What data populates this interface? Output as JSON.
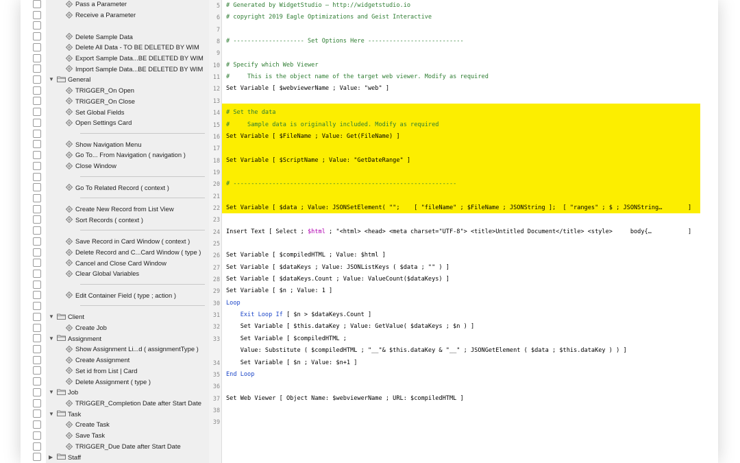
{
  "scripts": [
    {
      "type": "script",
      "label": "Pass a Parameter"
    },
    {
      "type": "script",
      "label": "Receive a Parameter"
    },
    {
      "type": "blank"
    },
    {
      "type": "script",
      "label": "Delete Sample Data"
    },
    {
      "type": "script",
      "label": "Delete All Data - TO BE DELETED BY WIM"
    },
    {
      "type": "script",
      "label": "Export Sample Data...BE DELETED BY WIM"
    },
    {
      "type": "script",
      "label": "Import Sample Data...BE DELETED BY WIM"
    },
    {
      "type": "folder",
      "label": "General"
    },
    {
      "type": "script",
      "label": "TRIGGER_On Open"
    },
    {
      "type": "script",
      "label": "TRIGGER_On Close"
    },
    {
      "type": "script",
      "label": "Set Global Fields"
    },
    {
      "type": "script",
      "label": "Open Settings Card"
    },
    {
      "type": "sep"
    },
    {
      "type": "script",
      "label": "Show Navigation Menu"
    },
    {
      "type": "script",
      "label": "Go To... From Navigation ( navigation )"
    },
    {
      "type": "script",
      "label": "Close Window"
    },
    {
      "type": "sep"
    },
    {
      "type": "script",
      "label": "Go To Related Record ( context )"
    },
    {
      "type": "sep"
    },
    {
      "type": "script",
      "label": "Create New Record from List View"
    },
    {
      "type": "script",
      "label": "Sort Records ( context )"
    },
    {
      "type": "sep"
    },
    {
      "type": "script",
      "label": "Save Record in Card Window ( context )"
    },
    {
      "type": "script",
      "label": "Delete Record and C...Card Window ( type )"
    },
    {
      "type": "script",
      "label": "Cancel and Close Card Window"
    },
    {
      "type": "script",
      "label": "Clear Global Variables"
    },
    {
      "type": "sep"
    },
    {
      "type": "script",
      "label": "Edit Container Field ( type ; action )"
    },
    {
      "type": "sep"
    },
    {
      "type": "folder",
      "label": "Client"
    },
    {
      "type": "script",
      "label": "Create Job"
    },
    {
      "type": "folder",
      "label": "Assignment"
    },
    {
      "type": "script",
      "label": "Show Assignment Li...d ( assignmentType )"
    },
    {
      "type": "script",
      "label": "Create Assignment"
    },
    {
      "type": "script",
      "label": "Set id from List | Card"
    },
    {
      "type": "script",
      "label": "Delete Assignment ( type )"
    },
    {
      "type": "folder",
      "label": "Job"
    },
    {
      "type": "script",
      "label": "TRIGGER_Completion Date after Start Date"
    },
    {
      "type": "folder",
      "label": "Task"
    },
    {
      "type": "script",
      "label": "Create Task"
    },
    {
      "type": "script",
      "label": "Save Task"
    },
    {
      "type": "script",
      "label": "TRIGGER_Due Date after Start Date"
    },
    {
      "type": "folder_collapsed",
      "label": "Staff"
    }
  ],
  "code_lines": [
    {
      "n": "5",
      "segments": [
        {
          "t": "# Generated by WidgetStudio – http://widgetstudio.io",
          "c": "green"
        }
      ]
    },
    {
      "n": "6",
      "segments": [
        {
          "t": "# copyright 2019 Eagle Optimizations and Geist Interactive",
          "c": "green"
        }
      ]
    },
    {
      "n": "7",
      "segments": []
    },
    {
      "n": "8",
      "segments": [
        {
          "t": "# -------------------- Set Options Here ---------------------------",
          "c": "green"
        }
      ]
    },
    {
      "n": "9",
      "segments": []
    },
    {
      "n": "10",
      "segments": [
        {
          "t": "# Specify which Web Viewer",
          "c": "green"
        }
      ]
    },
    {
      "n": "11",
      "segments": [
        {
          "t": "#     This is the object name of the target web viewer. Modify as required",
          "c": "green"
        }
      ]
    },
    {
      "n": "12",
      "segments": [
        {
          "t": "Set Variable [ $webviewerName ; Value: \"web\" ]",
          "c": "black"
        }
      ]
    },
    {
      "n": "13",
      "segments": []
    },
    {
      "n": "14",
      "segments": [
        {
          "t": "# Set the data",
          "c": "green"
        }
      ]
    },
    {
      "n": "15",
      "segments": [
        {
          "t": "#     Sample data is originally included. Modify as required",
          "c": "green"
        }
      ]
    },
    {
      "n": "16",
      "segments": [
        {
          "t": "Set Variable [ $FileName ; Value: Get(FileName) ]",
          "c": "black"
        }
      ]
    },
    {
      "n": "17",
      "segments": []
    },
    {
      "n": "18",
      "segments": [
        {
          "t": "Set Variable [ $ScriptName ; Value: \"GetDateRange\" ]",
          "c": "black"
        }
      ]
    },
    {
      "n": "19",
      "segments": []
    },
    {
      "n": "20",
      "segments": [
        {
          "t": "# ---------------------------------------------------------------",
          "c": "green"
        }
      ]
    },
    {
      "n": "21",
      "segments": []
    },
    {
      "n": "22",
      "segments": [
        {
          "t": "Set Variable [ $data ; Value: JSONSetElement( \"\";    [ \"fileName\" ; $FileName ; JSONString ];  [ \"ranges\" ; $ ; JSONString…",
          "c": "black"
        }
      ],
      "end": "]"
    },
    {
      "n": "23",
      "segments": []
    },
    {
      "n": "24",
      "segments": [
        {
          "t": "Insert Text [ Select ; ",
          "c": "black"
        },
        {
          "t": "$html",
          "c": "pink"
        },
        {
          "t": " ; \"<html> <head> <meta charset=\"UTF-8\"> <title>Untitled Document</title> <style>     body{…",
          "c": "black"
        }
      ],
      "end": "]"
    },
    {
      "n": "25",
      "segments": []
    },
    {
      "n": "26",
      "segments": [
        {
          "t": "Set Variable [ $compiledHTML ; Value: $html ]",
          "c": "black"
        }
      ]
    },
    {
      "n": "27",
      "segments": [
        {
          "t": "Set Variable [ $dataKeys ; Value: JSONListKeys ( $data ; \"\" ) ]",
          "c": "black"
        }
      ]
    },
    {
      "n": "28",
      "segments": [
        {
          "t": "Set Variable [ $dataKeys.Count ; Value: ValueCount($dataKeys) ]",
          "c": "black"
        }
      ]
    },
    {
      "n": "29",
      "segments": [
        {
          "t": "Set Variable [ $n ; Value: 1 ]",
          "c": "black"
        }
      ]
    },
    {
      "n": "30",
      "segments": [
        {
          "t": "Loop",
          "c": "blue"
        }
      ]
    },
    {
      "n": "31",
      "segments": [
        {
          "t": "    ",
          "c": "black"
        },
        {
          "t": "Exit Loop If",
          "c": "blue"
        },
        {
          "t": " [ $n > $dataKeys.Count ]",
          "c": "black"
        }
      ]
    },
    {
      "n": "32",
      "segments": [
        {
          "t": "    Set Variable [ $this.dataKey ; Value: GetValue( $dataKeys ; $n ) ]",
          "c": "black"
        }
      ]
    },
    {
      "n": "33",
      "segments": [
        {
          "t": "    Set Variable [ $compiledHTML ;",
          "c": "black"
        }
      ]
    },
    {
      "n": "",
      "segments": [
        {
          "t": "    Value: Substitute ( $compiledHTML ; \"__\"& $this.dataKey & \"__\" ; JSONGetElement ( $data ; $this.dataKey ) ) ]",
          "c": "black"
        }
      ]
    },
    {
      "n": "34",
      "segments": [
        {
          "t": "    Set Variable [ $n ; Value: $n+1 ]",
          "c": "black"
        }
      ]
    },
    {
      "n": "35",
      "segments": [
        {
          "t": "End Loop",
          "c": "blue"
        }
      ]
    },
    {
      "n": "36",
      "segments": []
    },
    {
      "n": "37",
      "segments": [
        {
          "t": "Set Web Viewer [ Object Name: $webviewerName ; URL: $compiledHTML ]",
          "c": "black"
        }
      ]
    },
    {
      "n": "38",
      "segments": []
    },
    {
      "n": "39",
      "segments": []
    }
  ],
  "colors": {
    "highlight": "#fcee00",
    "comment": "#2e7d32",
    "keyword": "#1c46c8",
    "variable": "#b100b1"
  }
}
